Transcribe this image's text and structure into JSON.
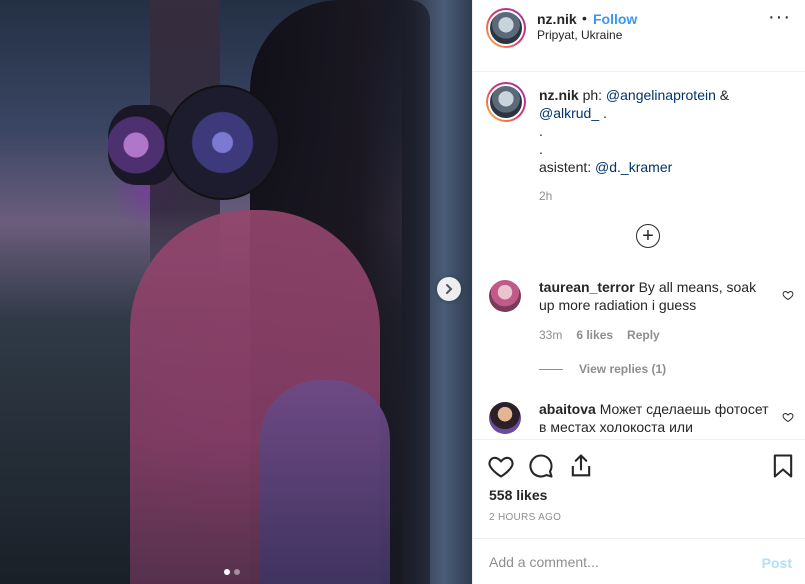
{
  "post": {
    "image_alt": "Photo of a woman wearing a gas mask",
    "carousel_total": 2,
    "carousel_active": 1
  },
  "header": {
    "username": "nz.nik",
    "separator": "•",
    "follow_label": "Follow",
    "location": "Pripyat, Ukraine",
    "more_label": "···"
  },
  "caption": {
    "username": "nz.nik",
    "text_prefix": "ph: ",
    "mention1": "@angelinaprotein",
    "and": " & ",
    "mention2": "@alkrud_",
    "after_mention2": " .",
    "line_dot1": ".",
    "line_dot2": ".",
    "assistant_label": "asistent: ",
    "mention3": "@d._kramer",
    "time": "2h"
  },
  "load_more_label": "+",
  "comments": [
    {
      "username": "taurean_terror",
      "text": "By all means, soak up more radiation i guess",
      "time": "33m",
      "likes": "6 likes",
      "reply": "Reply",
      "view_replies": "View replies (1)"
    },
    {
      "username": "abaitova",
      "text": "Может сделаешь фотосет в местах холокоста или"
    }
  ],
  "engagement": {
    "likes": "558 likes",
    "timestamp": "2 HOURS AGO"
  },
  "composer": {
    "placeholder": "Add a comment...",
    "post_label": "Post"
  },
  "colors": {
    "link": "#3897f0",
    "mention": "#003569",
    "muted": "#8e8e8e",
    "post_disabled": "#b2dffc"
  }
}
